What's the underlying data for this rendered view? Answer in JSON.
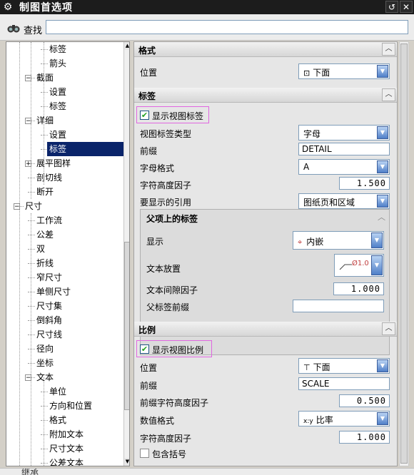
{
  "window": {
    "title": "制图首选项"
  },
  "search": {
    "label": "查找",
    "value": ""
  },
  "tree": {
    "items": [
      {
        "label": "标签",
        "level": 3
      },
      {
        "label": "箭头",
        "level": 3
      },
      {
        "label": "截面",
        "level": 2,
        "expander": "−"
      },
      {
        "label": "设置",
        "level": 3
      },
      {
        "label": "标签",
        "level": 3
      },
      {
        "label": "详细",
        "level": 2,
        "expander": "−"
      },
      {
        "label": "设置",
        "level": 3
      },
      {
        "label": "标签",
        "level": 3,
        "selected": true
      },
      {
        "label": "展平图样",
        "level": 2,
        "expander": "+"
      },
      {
        "label": "剖切线",
        "level": 2
      },
      {
        "label": "断开",
        "level": 2
      },
      {
        "label": "尺寸",
        "level": 1,
        "expander": "−"
      },
      {
        "label": "工作流",
        "level": 2
      },
      {
        "label": "公差",
        "level": 2
      },
      {
        "label": "双",
        "level": 2
      },
      {
        "label": "折线",
        "level": 2
      },
      {
        "label": "窄尺寸",
        "level": 2
      },
      {
        "label": "单侧尺寸",
        "level": 2
      },
      {
        "label": "尺寸集",
        "level": 2
      },
      {
        "label": "倒斜角",
        "level": 2
      },
      {
        "label": "尺寸线",
        "level": 2
      },
      {
        "label": "径向",
        "level": 2
      },
      {
        "label": "坐标",
        "level": 2
      },
      {
        "label": "文本",
        "level": 2,
        "expander": "−"
      },
      {
        "label": "单位",
        "level": 3
      },
      {
        "label": "方向和位置",
        "level": 3
      },
      {
        "label": "格式",
        "level": 3
      },
      {
        "label": "附加文本",
        "level": 3
      },
      {
        "label": "尺寸文本",
        "level": 3
      },
      {
        "label": "公差文本",
        "level": 3
      }
    ]
  },
  "format_section": {
    "title": "格式",
    "position_label": "位置",
    "position_value": "下面"
  },
  "label_section": {
    "title": "标签",
    "show_view_label": "显示视图标签",
    "show_view_label_checked": true,
    "label_type_label": "视图标签类型",
    "label_type_value": "字母",
    "prefix_label": "前缀",
    "prefix_value": "DETAIL",
    "letter_format_label": "字母格式",
    "letter_format_value": "A",
    "letter_height_label": "字符高度因子",
    "letter_height_value": "1.500",
    "reference_label": "要显示的引用",
    "reference_value": "图纸页和区域"
  },
  "parent_label_group": {
    "title": "父项上的标签",
    "display_label": "显示",
    "display_value": "内嵌",
    "text_placement_label": "文本放置",
    "text_placement_value": "Ø1.0",
    "text_gap_label": "文本间隙因子",
    "text_gap_value": "1.000",
    "parent_prefix_label": "父标签前缀",
    "parent_prefix_value": ""
  },
  "scale_section": {
    "title": "比例",
    "show_view_scale": "显示视图比例",
    "show_view_scale_checked": true,
    "position_label": "位置",
    "position_value": "下面",
    "prefix_label": "前缀",
    "prefix_value": "SCALE",
    "prefix_height_label": "前缀字符高度因子",
    "prefix_height_value": "0.500",
    "number_format_label": "数值格式",
    "number_format_icon": "x:y",
    "number_format_value": "比率",
    "char_height_label": "字符高度因子",
    "char_height_value": "1.000",
    "include_parens_label": "包含括号",
    "include_parens_checked": false
  },
  "bottom": {
    "text": "继承"
  }
}
